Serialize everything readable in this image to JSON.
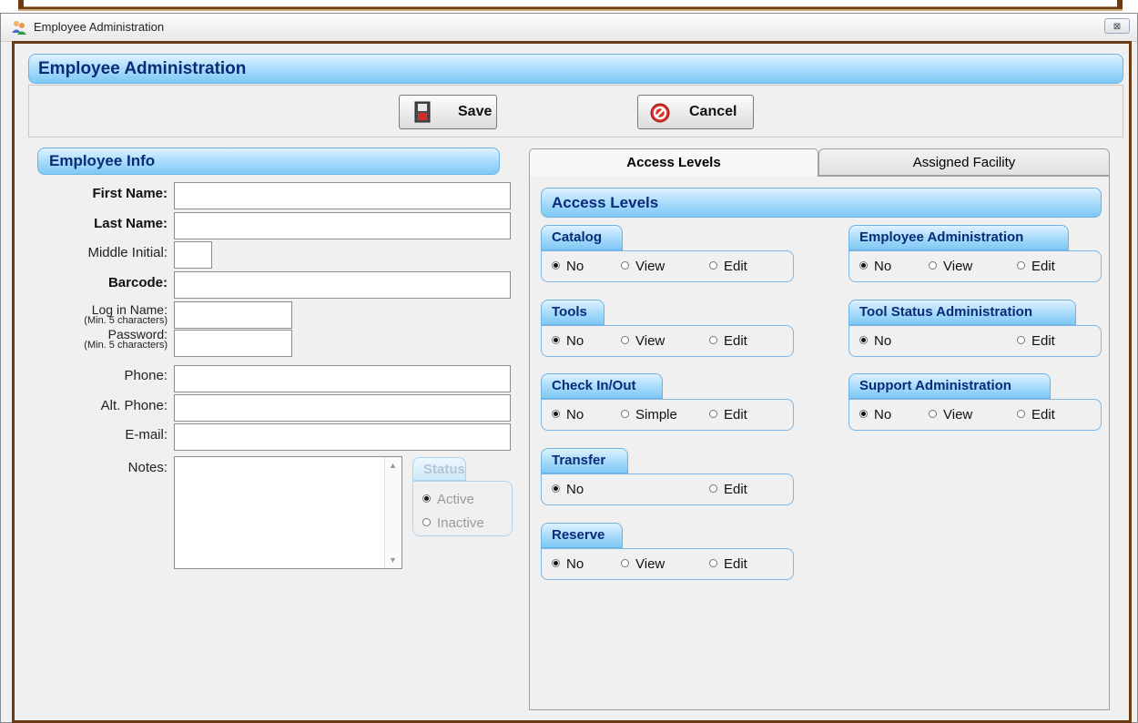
{
  "window": {
    "title": "Employee Administration",
    "close_glyph": "⊠"
  },
  "main_header": "Employee Administration",
  "toolbar": {
    "save_label": "Save",
    "cancel_label": "Cancel"
  },
  "employee_info": {
    "header": "Employee Info",
    "first_name_label": "First Name:",
    "last_name_label": "Last Name:",
    "middle_initial_label": "Middle Initial:",
    "barcode_label": "Barcode:",
    "login_name_label": "Log in Name:",
    "login_note": "(Min. 5 characters)",
    "password_label": "Password:",
    "password_note": "(Min. 5 characters)",
    "phone_label": "Phone:",
    "alt_phone_label": "Alt. Phone:",
    "email_label": "E-mail:",
    "notes_label": "Notes:",
    "first_name": "",
    "last_name": "",
    "middle_initial": "",
    "barcode": "",
    "login_name": "",
    "password": "",
    "phone": "",
    "alt_phone": "",
    "email": "",
    "notes": ""
  },
  "status": {
    "title": "Status",
    "active_label": "Active",
    "inactive_label": "Inactive",
    "selected": "Active"
  },
  "tabs": {
    "access_levels": "Access Levels",
    "assigned_facility": "Assigned Facility"
  },
  "access": {
    "header": "Access Levels",
    "groups": {
      "catalog": {
        "title": "Catalog",
        "o1": "No",
        "o2": "View",
        "o3": "Edit",
        "selected": "No"
      },
      "tools": {
        "title": "Tools",
        "o1": "No",
        "o2": "View",
        "o3": "Edit",
        "selected": "No"
      },
      "checkinout": {
        "title": "Check In/Out",
        "o1": "No",
        "o2": "Simple",
        "o3": "Edit",
        "selected": "No"
      },
      "transfer": {
        "title": "Transfer",
        "o1": "No",
        "o3": "Edit",
        "selected": "No"
      },
      "reserve": {
        "title": "Reserve",
        "o1": "No",
        "o2": "View",
        "o3": "Edit",
        "selected": "No"
      },
      "employee_admin": {
        "title": "Employee Administration",
        "o1": "No",
        "o2": "View",
        "o3": "Edit",
        "selected": "No"
      },
      "tool_status_admin": {
        "title": "Tool Status Administration",
        "o1": "No",
        "o3": "Edit",
        "selected": "No"
      },
      "support_admin": {
        "title": "Support Administration",
        "o1": "No",
        "o2": "View",
        "o3": "Edit",
        "selected": "No"
      }
    }
  },
  "colors": {
    "frame_brown": "#6b3c13",
    "header_blue": "#7ec8f5",
    "header_text": "#0b2a78"
  }
}
